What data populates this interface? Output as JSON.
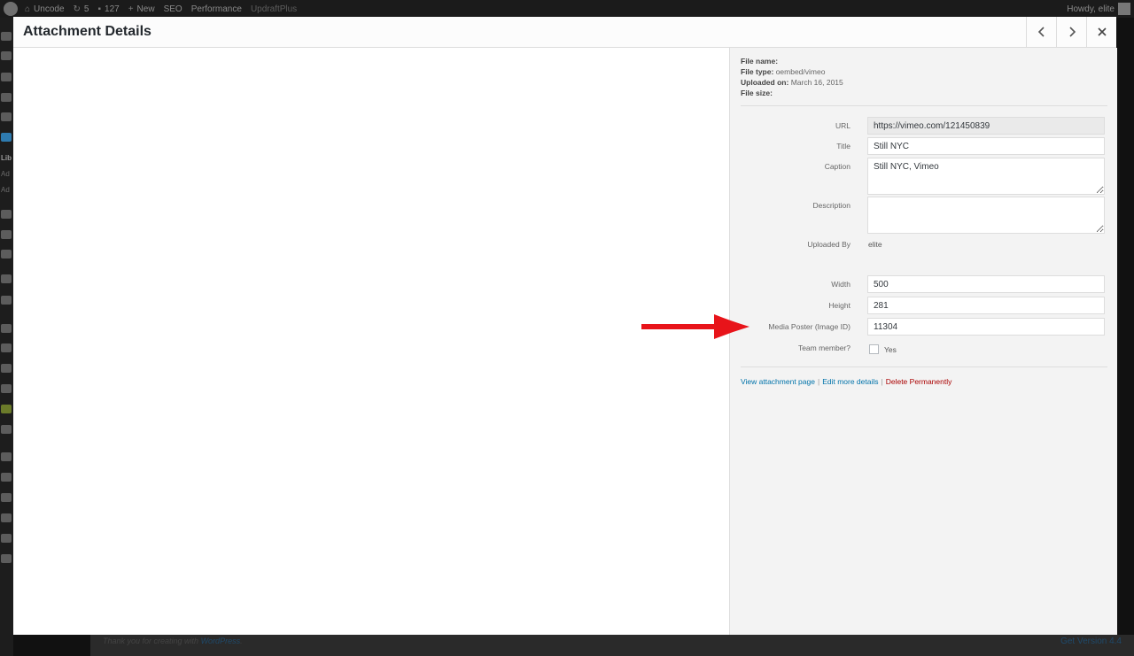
{
  "adminbar": {
    "site_name": "Uncode",
    "updates_count": "5",
    "comments_count": "127",
    "new_label": "New",
    "seo_label": "SEO",
    "performance_label": "Performance",
    "updraft_label": "UpdraftPlus",
    "howdy": "Howdy, elite"
  },
  "sidemenu": {
    "current_label": "Lib",
    "sub1": "Ad",
    "sub2": "Ad"
  },
  "modal": {
    "title": "Attachment Details",
    "prev_icon": "chevron-left-icon",
    "next_icon": "chevron-right-icon",
    "close_icon": "close-icon"
  },
  "meta": {
    "file_name_label": "File name:",
    "file_name": "",
    "file_type_label": "File type:",
    "file_type": "oembed/vimeo",
    "uploaded_on_label": "Uploaded on:",
    "uploaded_on": "March 16, 2015",
    "file_size_label": "File size:",
    "file_size": ""
  },
  "fields": {
    "url_label": "URL",
    "url_value": "https://vimeo.com/121450839",
    "title_label": "Title",
    "title_value": "Still NYC",
    "caption_label": "Caption",
    "caption_value": "Still NYC, Vimeo",
    "description_label": "Description",
    "description_value": "",
    "uploaded_by_label": "Uploaded By",
    "uploaded_by_value": "elite",
    "width_label": "Width",
    "width_value": "500",
    "height_label": "Height",
    "height_value": "281",
    "poster_label": "Media Poster (Image ID)",
    "poster_value": "11304",
    "team_label": "Team member?",
    "team_option": "Yes",
    "team_checked": false
  },
  "actions": {
    "view": "View attachment page",
    "edit": "Edit more details",
    "delete": "Delete Permanently",
    "separator": "|"
  },
  "footer": {
    "thanks_prefix": "Thank you for creating with ",
    "thanks_link": "WordPress",
    "thanks_suffix": ".",
    "version": "Get Version 4.4"
  },
  "colors": {
    "annotation_arrow": "#e8141a",
    "link": "#0073aa",
    "danger": "#aa0000"
  }
}
